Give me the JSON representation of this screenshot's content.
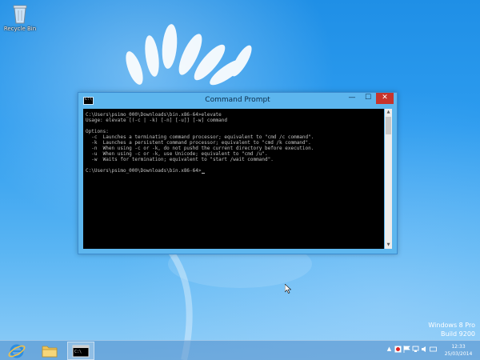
{
  "desktop": {
    "recycle_bin_label": "Recycle Bin"
  },
  "window": {
    "title": "Command Prompt",
    "icon_label": "C:\\",
    "minimize_glyph": "—",
    "maximize_glyph": "☐",
    "close_glyph": "✕",
    "console_lines": "C:\\Users\\psimo_000\\Downloads\\bin.x86-64>elevate\nUsage: elevate [(-c | -k) [-n] [-u]] [-w] command\n\nOptions:\n  -c  Launches a terminating command processor; equivalent to \"cmd /c command\".\n  -k  Launches a persistent command processor; equivalent to \"cmd /k command\".\n  -n  When using -c or -k, do not pushd the current directory before execution.\n  -u  When using -c or -k, use Unicode; equivalent to \"cmd /u\".\n  -w  Waits for termination; equivalent to \"start /wait command\".\n\nC:\\Users\\psimo_000\\Downloads\\bin.x86-64>",
    "scroll_up_glyph": "▲",
    "scroll_down_glyph": "▼"
  },
  "watermark": {
    "line1": "Windows 8 Pro",
    "line2": "Build 9200"
  },
  "taskbar": {
    "cmd_label": "C:\\",
    "clock_time": "12:33",
    "clock_date": "25/03/2014",
    "tray_icons": [
      "chevron-up-icon",
      "action-center-icon",
      "flag-icon",
      "network-icon",
      "volume-icon",
      "keyboard-icon"
    ]
  }
}
